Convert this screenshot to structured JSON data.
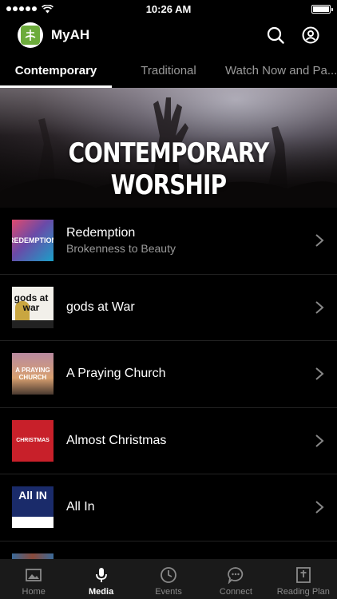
{
  "status_bar": {
    "time": "10:26 AM",
    "signal_icon": "signal-dots-icon",
    "wifi_icon": "wifi-icon",
    "battery_icon": "battery-icon"
  },
  "header": {
    "app_title": "MyAH",
    "logo_icon": "church-logo-icon",
    "search_icon": "search-icon",
    "account_icon": "account-icon"
  },
  "tabs": [
    {
      "label": "Contemporary",
      "active": true
    },
    {
      "label": "Traditional",
      "active": false
    },
    {
      "label": "Watch Now  and Pa...",
      "active": false
    }
  ],
  "hero": {
    "title": "CONTEMPORARY WORSHIP"
  },
  "series": [
    {
      "title": "Redemption",
      "subtitle": "Brokenness to Beauty",
      "thumb_text": "REDEMPTION",
      "thumb_colors": [
        "#e04a6e",
        "#1aa0c8"
      ]
    },
    {
      "title": "gods at War",
      "subtitle": "",
      "thumb_text": "gods at war",
      "thumb_colors": [
        "#f2f0ea",
        "#c9a640"
      ]
    },
    {
      "title": "A Praying Church",
      "subtitle": "",
      "thumb_text": "A PRAYING CHURCH",
      "thumb_colors": [
        "#b88aa0",
        "#d8a070"
      ]
    },
    {
      "title": "Almost Christmas",
      "subtitle": "",
      "thumb_text": "CHRISTMAS",
      "thumb_colors": [
        "#c8202a"
      ]
    },
    {
      "title": "All In",
      "subtitle": "",
      "thumb_text": "All IN",
      "thumb_colors": [
        "#1a2b6a",
        "#ffffff"
      ]
    }
  ],
  "bottom_nav": [
    {
      "label": "Home",
      "icon": "image-icon",
      "active": false
    },
    {
      "label": "Media",
      "icon": "microphone-icon",
      "active": true
    },
    {
      "label": "Events",
      "icon": "clock-icon",
      "active": false
    },
    {
      "label": "Connect",
      "icon": "chat-bubble-icon",
      "active": false
    },
    {
      "label": "Reading Plan",
      "icon": "bible-icon",
      "active": false
    }
  ]
}
